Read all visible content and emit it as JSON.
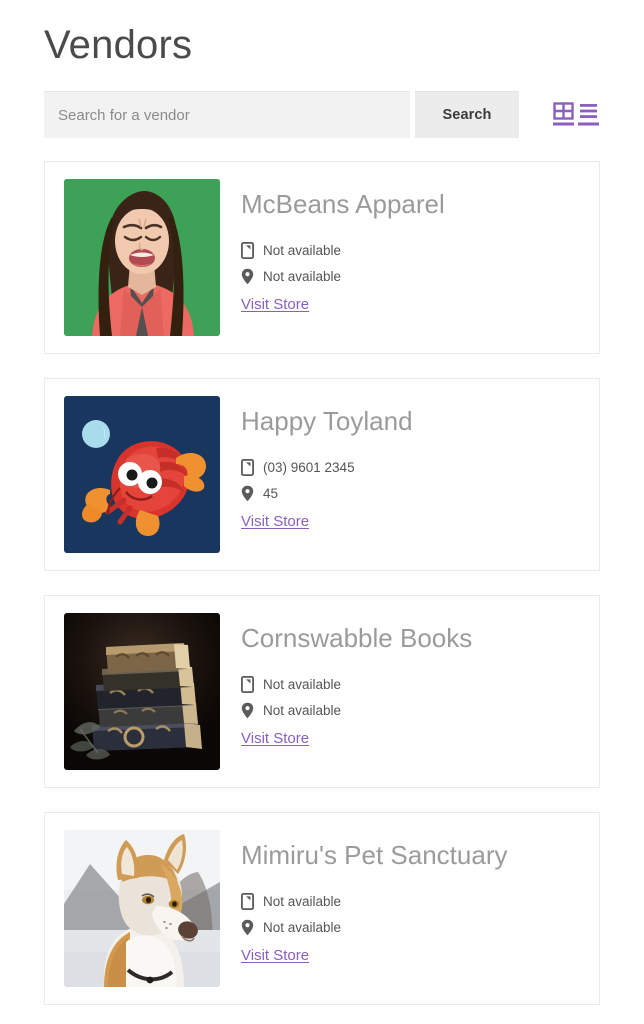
{
  "header": {
    "title": "Vendors"
  },
  "search": {
    "placeholder": "Search for a vendor",
    "value": "",
    "button_label": "Search"
  },
  "view_toggles": [
    {
      "name": "grid-view",
      "icon": "grid-icon",
      "active": true,
      "color": "#8a5fc0"
    },
    {
      "name": "list-view",
      "icon": "list-icon",
      "active": true,
      "color": "#8a5fc0"
    }
  ],
  "colors": {
    "link": "#8a5fc0",
    "title": "#4a4a4a",
    "vendor_name": "#9b9b9b",
    "card_border": "#eceaea",
    "input_bg": "#f2f2f2",
    "button_bg": "#ececec"
  },
  "vendors": [
    {
      "name": "McBeans Apparel",
      "phone_icon": "mobile-phone-icon",
      "phone": "Not available",
      "location_icon": "map-pin-icon",
      "location": "Not available",
      "link_label": "Visit Store",
      "image_alt": "crying-woman-on-green-background"
    },
    {
      "name": "Happy Toyland",
      "phone_icon": "mobile-phone-icon",
      "phone": "(03) 9601 2345",
      "location_icon": "map-pin-icon",
      "location": "45",
      "link_label": "Visit Store",
      "image_alt": "red-clay-lobster-toy-on-navy-background"
    },
    {
      "name": "Cornswabble Books",
      "phone_icon": "mobile-phone-icon",
      "phone": "Not available",
      "location_icon": "map-pin-icon",
      "location": "Not available",
      "link_label": "Visit Store",
      "image_alt": "stack-of-antique-books-dark"
    },
    {
      "name": "Mimiru's Pet Sanctuary",
      "phone_icon": "mobile-phone-icon",
      "phone": "Not available",
      "location_icon": "map-pin-icon",
      "location": "Not available",
      "link_label": "Visit Store",
      "image_alt": "red-and-white-husky-dog-in-snow"
    }
  ]
}
